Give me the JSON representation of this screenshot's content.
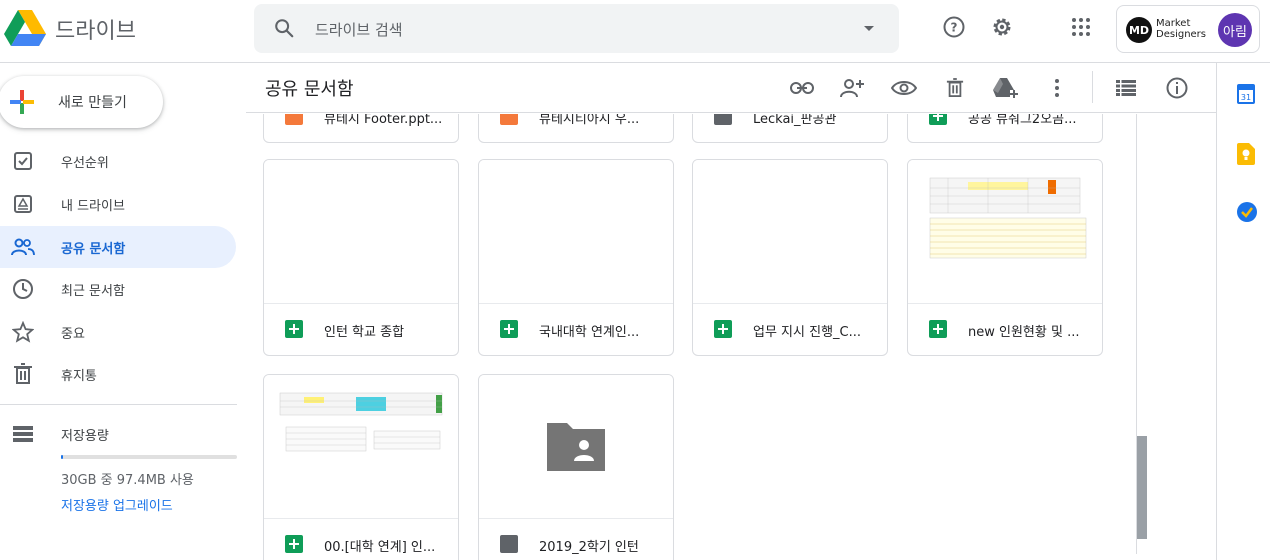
{
  "app": {
    "title": "드라이브"
  },
  "search": {
    "placeholder": "드라이브 검색"
  },
  "account": {
    "org_line1": "Market",
    "org_line2": "Designers",
    "org_initials": "MD",
    "avatar": "아림"
  },
  "sidebar": {
    "new_button": "새로 만들기",
    "items": [
      {
        "label": "우선순위",
        "icon": "priority-icon"
      },
      {
        "label": "내 드라이브",
        "icon": "my-drive-icon"
      },
      {
        "label": "공유 문서함",
        "icon": "shared-icon",
        "active": true
      },
      {
        "label": "최근 문서함",
        "icon": "clock-icon"
      },
      {
        "label": "중요",
        "icon": "star-icon"
      },
      {
        "label": "휴지통",
        "icon": "trash-icon"
      }
    ],
    "storage": {
      "label": "저장용량",
      "usage": "30GB 중 97.4MB 사용",
      "upgrade": "저장용량 업그레이드",
      "used_fraction": 0.003
    }
  },
  "main": {
    "title": "공유 문서함",
    "top_row_files": [
      {
        "name": "뷰테시 Footer.ppt...",
        "type": "slides"
      },
      {
        "name": "뷰테시티아시 우...",
        "type": "slides"
      },
      {
        "name": "Leckai_판공관",
        "type": "shared-folder"
      },
      {
        "name": "공공 뷰줘그2오곰...",
        "type": "sheet"
      }
    ],
    "files": [
      {
        "name": "인턴 학교 종합",
        "type": "sheet"
      },
      {
        "name": "국내대학 연계인...",
        "type": "sheet"
      },
      {
        "name": "업무 지시 진행_C...",
        "type": "sheet"
      },
      {
        "name": "new 인원현황 및 ...",
        "type": "sheet"
      },
      {
        "name": "00.[대학 연계] 인...",
        "type": "sheet"
      },
      {
        "name": "2019_2학기 인턴",
        "type": "shared-folder"
      }
    ]
  },
  "colors": {
    "accent": "#1a73e8",
    "active_bg": "#e8f0fe",
    "sheet_green": "#0f9d58"
  }
}
